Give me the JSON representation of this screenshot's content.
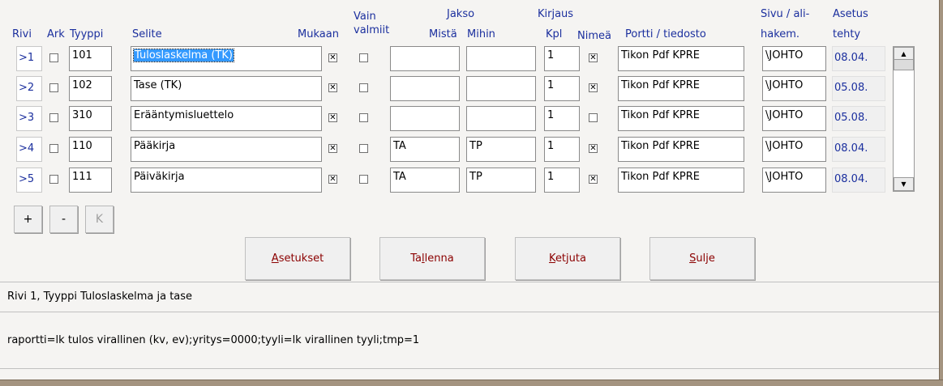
{
  "headers": {
    "rivi": "Rivi",
    "ark": "Ark",
    "tyyppi": "Tyyppi",
    "selite": "Selite",
    "mukaan": "Mukaan",
    "vain": "Vain",
    "valmiit": "valmiit",
    "jakso": "Jakso",
    "mista": "Mistä",
    "mihin": "Mihin",
    "kirjaus": "Kirjaus",
    "kpl": "Kpl",
    "nimea": "Nimeä",
    "portti": "Portti / tiedosto",
    "sivu": "Sivu / ali-",
    "hakem": "hakem.",
    "asetus": "Asetus",
    "tehty": "tehty"
  },
  "rows": [
    {
      "rivi": ">1",
      "ark": false,
      "tyyppi": "101",
      "selite": "Tuloslaskelma (TK)",
      "mukaan": true,
      "vain": false,
      "mista": "",
      "mihin": "",
      "kpl": "1",
      "nimea": true,
      "portti": "Tikon Pdf KPRE",
      "sivu": "\\JOHTO",
      "asetus": "08.04."
    },
    {
      "rivi": ">2",
      "ark": false,
      "tyyppi": "102",
      "selite": "Tase (TK)",
      "mukaan": true,
      "vain": false,
      "mista": "",
      "mihin": "",
      "kpl": "1",
      "nimea": true,
      "portti": "Tikon Pdf KPRE",
      "sivu": "\\JOHTO",
      "asetus": "05.08."
    },
    {
      "rivi": ">3",
      "ark": false,
      "tyyppi": "310",
      "selite": "Erääntymisluettelo",
      "mukaan": true,
      "vain": false,
      "mista": "",
      "mihin": "",
      "kpl": "1",
      "nimea": false,
      "portti": "Tikon Pdf KPRE",
      "sivu": "\\JOHTO",
      "asetus": "05.08."
    },
    {
      "rivi": ">4",
      "ark": false,
      "tyyppi": "110",
      "selite": "Pääkirja",
      "mukaan": true,
      "vain": false,
      "mista": "TA",
      "mihin": "TP",
      "kpl": "1",
      "nimea": true,
      "portti": "Tikon Pdf KPRE",
      "sivu": "\\JOHTO",
      "asetus": "08.04."
    },
    {
      "rivi": ">5",
      "ark": false,
      "tyyppi": "111",
      "selite": "Päiväkirja",
      "mukaan": true,
      "vain": false,
      "mista": "TA",
      "mihin": "TP",
      "kpl": "1",
      "nimea": true,
      "portti": "Tikon Pdf KPRE",
      "sivu": "\\JOHTO",
      "asetus": "08.04."
    }
  ],
  "row_buttons": {
    "add": "+",
    "remove": "-",
    "k": "K"
  },
  "buttons": {
    "asetukset_u": "A",
    "asetukset_rest": "setukset",
    "tallenna_pre": "Ta",
    "tallenna_u": "l",
    "tallenna_rest": "lenna",
    "ketjuta_u": "K",
    "ketjuta_rest": "etjuta",
    "sulje_u": "S",
    "sulje_rest": "ulje"
  },
  "status_line": "Rivi 1, Tyyppi Tuloslaskelma ja tase",
  "params_line": "raportti=lk tulos virallinen (kv, ev);yritys=0000;tyyli=lk virallinen tyyli;tmp=1",
  "colors": {
    "header": "#1b2f9e",
    "button_text": "#8b0000",
    "selection": "#3399ff"
  }
}
